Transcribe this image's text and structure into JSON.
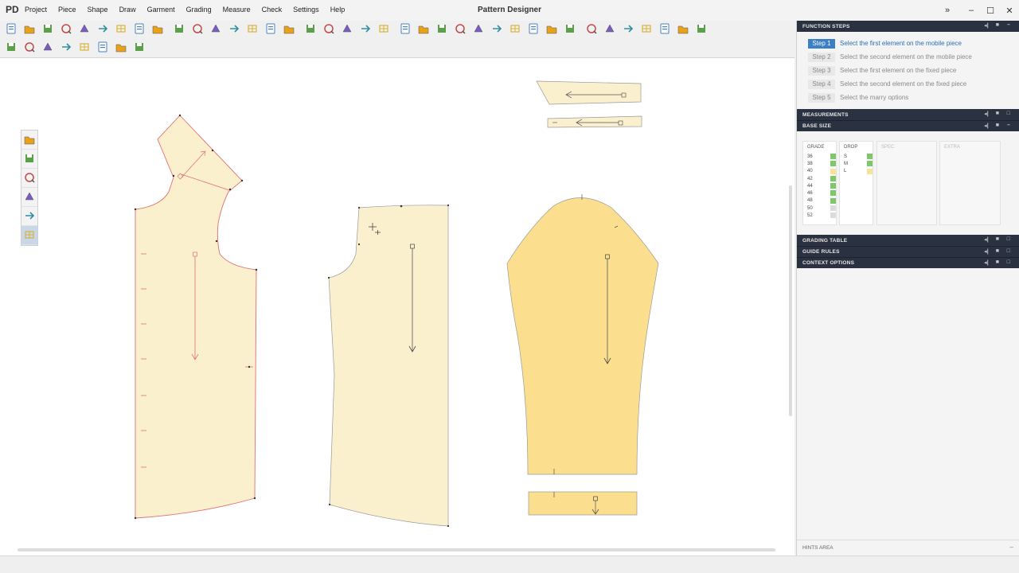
{
  "app": {
    "logo": "PD",
    "title": "Pattern Designer"
  },
  "menu": [
    "Project",
    "Piece",
    "Shape",
    "Draw",
    "Garment",
    "Grading",
    "Measure",
    "Check",
    "Settings",
    "Help"
  ],
  "window_controls": {
    "expand": "»",
    "minimize": "–",
    "maximize": "☐",
    "close": "✕"
  },
  "toolbar_icons": [
    "new-icon",
    "open-icon",
    "save-icon",
    "import-icon",
    "properties-icon",
    "copy-icon",
    "paste-icon",
    "print-icon",
    "plot-icon",
    "undo-icon",
    "redo-icon",
    "piece-icon",
    "pieces-icon",
    "stack-icon",
    "folder-icon",
    "tag-icon",
    "color-wheel-icon",
    "grid-icon",
    "marker-icon",
    "play-icon",
    "table-icon",
    "flag-icon",
    "zoom-icon",
    "zoom-window-icon",
    "zoom-fit-icon",
    "zoom-all-icon",
    "zoom-in-icon",
    "zoom-out-icon",
    "refresh-icon",
    "plus-icon",
    "layers-icon",
    "bus-icon",
    "help-icon",
    "grade-icon",
    "pin-icon",
    "check-icon",
    "error-icon",
    "eye-icon"
  ],
  "toolbar2_icons": [
    "garment-icon",
    "jacket-icon",
    "bow-icon",
    "sleeve-icon",
    "ruler-a-icon",
    "ruler-b-icon",
    "arrow-icon",
    "curve-icon"
  ],
  "palette_icons": [
    "pointer-icon",
    "curve-tool-icon",
    "edit-tool-icon",
    "pen-tool-icon",
    "ruler-tool-icon",
    "stack-tool-icon"
  ],
  "panels": {
    "function_steps": {
      "title": "FUNCTION STEPS",
      "steps": [
        {
          "label": "Step 1",
          "text": "Select the first element on the mobile piece",
          "active": true
        },
        {
          "label": "Step 2",
          "text": "Select the second element on the mobile piece",
          "active": false
        },
        {
          "label": "Step 3",
          "text": "Select the first element on the fixed piece",
          "active": false
        },
        {
          "label": "Step 4",
          "text": "Select the second element on the fixed piece",
          "active": false
        },
        {
          "label": "Step 5",
          "text": "Select the marry options",
          "active": false
        }
      ]
    },
    "measurements": {
      "title": "MEASUREMENTS"
    },
    "base_size": {
      "title": "BASE SIZE",
      "columns": {
        "grade": "GRADE",
        "drop": "DROP",
        "spec": "SPEC",
        "extra": "EXTRA"
      },
      "grades": [
        "36",
        "38",
        "40",
        "42",
        "44",
        "46",
        "48",
        "50",
        "52"
      ],
      "grade_status": [
        "green",
        "green",
        "yellow",
        "green",
        "green",
        "green",
        "green",
        "gray",
        "gray"
      ],
      "drops": [
        "S",
        "M",
        "L"
      ],
      "drop_status": [
        "green",
        "green",
        "yellow"
      ]
    },
    "grading_table": {
      "title": "GRADING TABLE"
    },
    "guide_rules": {
      "title": "GUIDE RULES"
    },
    "context_options": {
      "title": "CONTEXT OPTIONS"
    },
    "hints": {
      "title": "HINTS AREA"
    }
  },
  "colors": {
    "piece_fill_light": "#fbf0ce",
    "piece_fill_dark": "#fbdf8e",
    "piece_outline_selected": "#e07070",
    "panel_header": "#2a3140",
    "step_active": "#3b7fc4",
    "status_green": "#7ec86a",
    "status_yellow": "#f5e49a",
    "status_gray": "#dcdcdc"
  }
}
